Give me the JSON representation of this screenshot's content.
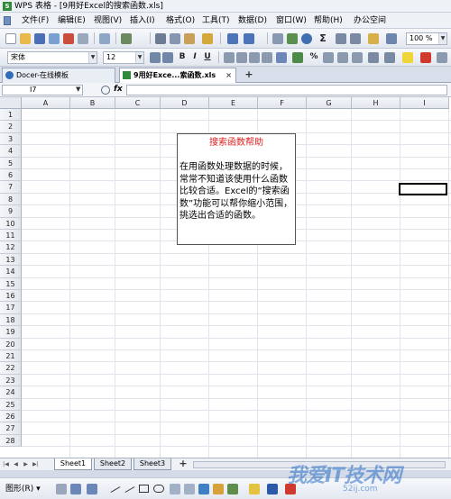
{
  "window": {
    "title": "WPS 表格 - [9用好Excel的搜索函数.xls]",
    "app_icon": "S"
  },
  "menubar": {
    "items": [
      "文件(F)",
      "编辑(E)",
      "视图(V)",
      "插入(I)",
      "格式(O)",
      "工具(T)",
      "数据(D)",
      "窗口(W)",
      "帮助(H)",
      "办公空间"
    ]
  },
  "toolbar": {
    "sigma": "Σ",
    "zoom": "100 %"
  },
  "format_toolbar": {
    "font_name": "宋体",
    "font_size": "12",
    "bold": "B",
    "italic": "I",
    "underline": "U",
    "percent": "%"
  },
  "tabs": [
    {
      "label": "Docer-在线模板",
      "active": false
    },
    {
      "label": "9用好Exce...索函数.xls",
      "active": true
    }
  ],
  "tab_add": "+",
  "formula_bar": {
    "name_box": "I7",
    "fx": "fx",
    "formula": ""
  },
  "grid": {
    "columns": [
      "A",
      "B",
      "C",
      "D",
      "E",
      "F",
      "G",
      "H",
      "I"
    ],
    "rows": [
      "1",
      "2",
      "3",
      "4",
      "5",
      "6",
      "7",
      "8",
      "9",
      "10",
      "11",
      "12",
      "13",
      "14",
      "15",
      "16",
      "17",
      "18",
      "19",
      "20",
      "21",
      "22",
      "23",
      "24",
      "25",
      "26",
      "27",
      "28"
    ],
    "selected_cell": "I7"
  },
  "textbox": {
    "title": "搜索函数帮助",
    "body": "在用函数处理数据的时候，常常不知道该使用什么函数比较合适。Excel的“搜索函数”功能可以帮你缩小范围，挑选出合适的函数。"
  },
  "sheets": [
    "Sheet1",
    "Sheet2",
    "Sheet3"
  ],
  "sheet_add": "+",
  "drawing_toolbar": {
    "label": "图形(R) ▾"
  },
  "watermark": {
    "text": "我爱IT技术网",
    "url": "52ij.com"
  }
}
